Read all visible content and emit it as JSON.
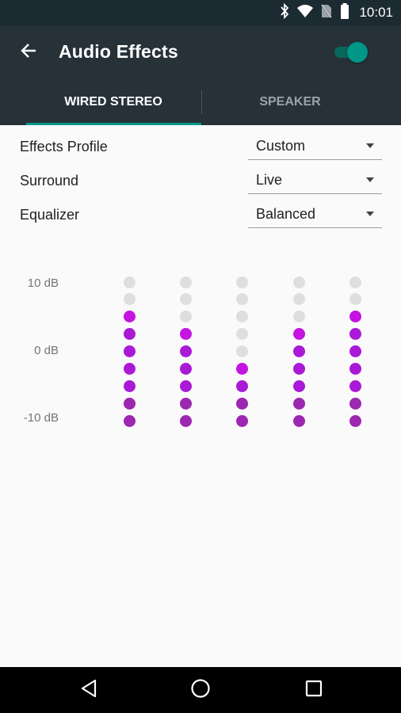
{
  "status_bar": {
    "time": "10:01",
    "icons": [
      "bluetooth-icon",
      "wifi-icon",
      "no-sim-icon",
      "battery-icon"
    ]
  },
  "app_bar": {
    "title": "Audio Effects",
    "switch_on": true
  },
  "tabs": [
    {
      "label": "WIRED STEREO",
      "selected": true
    },
    {
      "label": "SPEAKER",
      "selected": false
    }
  ],
  "settings": {
    "effects_profile": {
      "label": "Effects Profile",
      "value": "Custom"
    },
    "surround": {
      "label": "Surround",
      "value": "Live"
    },
    "equalizer": {
      "label": "Equalizer",
      "value": "Balanced"
    }
  },
  "eq": {
    "scale_labels": [
      "10 dB",
      "0 dB",
      "-10 dB"
    ],
    "dots_per_band": 9,
    "lit_counts": [
      7,
      6,
      4,
      6,
      7
    ],
    "colors": {
      "lit": "#aa1ad6",
      "lit_top": "#c414e0",
      "lit_bottom": "#9c27b0",
      "unlit": "#dedede"
    }
  },
  "colors": {
    "status_bar": "#1c2a31",
    "app_bar": "#263238",
    "accent": "#009688",
    "background": "#fafafa"
  },
  "nav_bar": {
    "buttons": [
      "back-nav-icon",
      "home-nav-icon",
      "recents-nav-icon"
    ]
  }
}
